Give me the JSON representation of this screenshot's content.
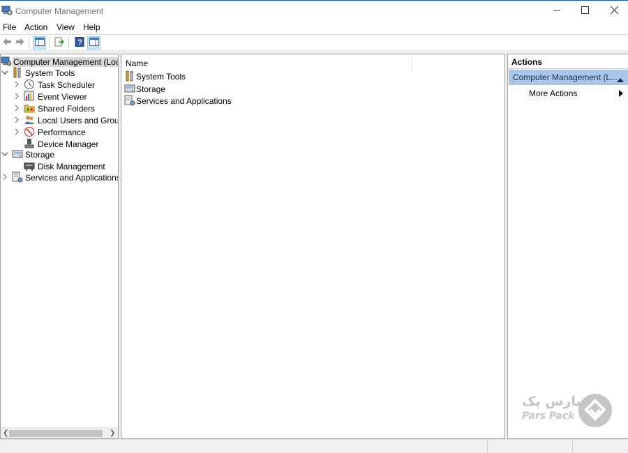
{
  "window": {
    "title": "Computer Management",
    "app_icon": "computer-management-icon",
    "controls": [
      "minimize-icon",
      "maximize-icon",
      "close-icon"
    ]
  },
  "menu": {
    "items": [
      "File",
      "Action",
      "View",
      "Help"
    ]
  },
  "toolbar": {
    "buttons": [
      "back-arrow-icon",
      "forward-arrow-icon",
      "show-hide-console-tree-icon",
      "export-list-icon",
      "help-icon",
      "show-hide-action-pane-icon"
    ]
  },
  "tree": {
    "root": {
      "label": "Computer Management (Local",
      "icon": "computer-management-icon"
    },
    "items": [
      {
        "label": "System Tools",
        "icon": "tools-icon",
        "expander": "expanded"
      },
      {
        "label": "Task Scheduler",
        "icon": "clock-icon",
        "expander": "collapsed"
      },
      {
        "label": "Event Viewer",
        "icon": "event-viewer-icon",
        "expander": "collapsed"
      },
      {
        "label": "Shared Folders",
        "icon": "shared-folders-icon",
        "expander": "collapsed"
      },
      {
        "label": "Local Users and Groups",
        "icon": "users-icon",
        "expander": "collapsed"
      },
      {
        "label": "Performance",
        "icon": "performance-icon",
        "expander": "collapsed"
      },
      {
        "label": "Device Manager",
        "icon": "device-manager-icon",
        "expander": "none"
      },
      {
        "label": "Storage",
        "icon": "storage-icon",
        "expander": "expanded"
      },
      {
        "label": "Disk Management",
        "icon": "disk-icon",
        "expander": "none"
      },
      {
        "label": "Services and Applications",
        "icon": "services-icon",
        "expander": "collapsed"
      }
    ]
  },
  "list": {
    "column_header": "Name",
    "rows": [
      {
        "label": "System Tools",
        "icon": "tools-icon"
      },
      {
        "label": "Storage",
        "icon": "storage-icon"
      },
      {
        "label": "Services and Applications",
        "icon": "services-icon"
      }
    ]
  },
  "actions": {
    "header": "Actions",
    "section_title": "Computer Management (L...",
    "items": [
      {
        "label": "More Actions"
      }
    ]
  },
  "watermark": {
    "text_fa": "پارس پک",
    "text_en": "Pars Pack"
  },
  "colors": {
    "selection": "#d9d9d9",
    "action_section": "#a9c6e6",
    "accent": "#1b5aa8"
  }
}
